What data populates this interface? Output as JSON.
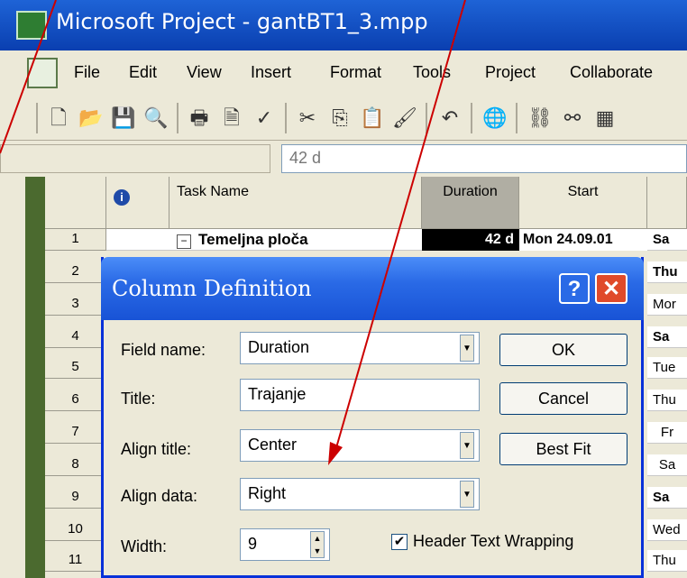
{
  "app": {
    "title": "Microsoft Project - gantBT1_3.mpp"
  },
  "menu": [
    "File",
    "Edit",
    "View",
    "Insert",
    "Format",
    "Tools",
    "Project",
    "Collaborate"
  ],
  "entry_value": "42 d",
  "columns": {
    "info": "i",
    "task_name": "Task Name",
    "duration": "Duration",
    "start": "Start"
  },
  "rows": [
    {
      "id": "1",
      "task": "Temeljna ploča",
      "duration": "42 d",
      "start": "Mon 24.09.01",
      "next": "Sa"
    },
    {
      "id": "2",
      "next": "Thu"
    },
    {
      "id": "3",
      "next": "Mor"
    },
    {
      "id": "4",
      "next": "Sa"
    },
    {
      "id": "5",
      "next": "Tue"
    },
    {
      "id": "6",
      "next": "Thu"
    },
    {
      "id": "7",
      "next": "Fr"
    },
    {
      "id": "8",
      "next": "Sa"
    },
    {
      "id": "9",
      "next": "Sa"
    },
    {
      "id": "10",
      "next": "Wed"
    },
    {
      "id": "11",
      "next": "Thu"
    }
  ],
  "dialog": {
    "title": "Column Definition",
    "field_name_label": "Field name:",
    "field_name_value": "Duration",
    "title_label": "Title:",
    "title_value": "Trajanje",
    "align_title_label": "Align title:",
    "align_title_value": "Center",
    "align_data_label": "Align data:",
    "align_data_value": "Right",
    "width_label": "Width:",
    "width_value": "9",
    "header_wrap_label": "Header Text Wrapping",
    "ok": "OK",
    "cancel": "Cancel",
    "best_fit": "Best Fit"
  },
  "colors": {
    "title_bar": "#0a3fb0",
    "dialog_title": "#2a6ae6",
    "close": "#e04a2a",
    "arrow": "#cc0000"
  }
}
